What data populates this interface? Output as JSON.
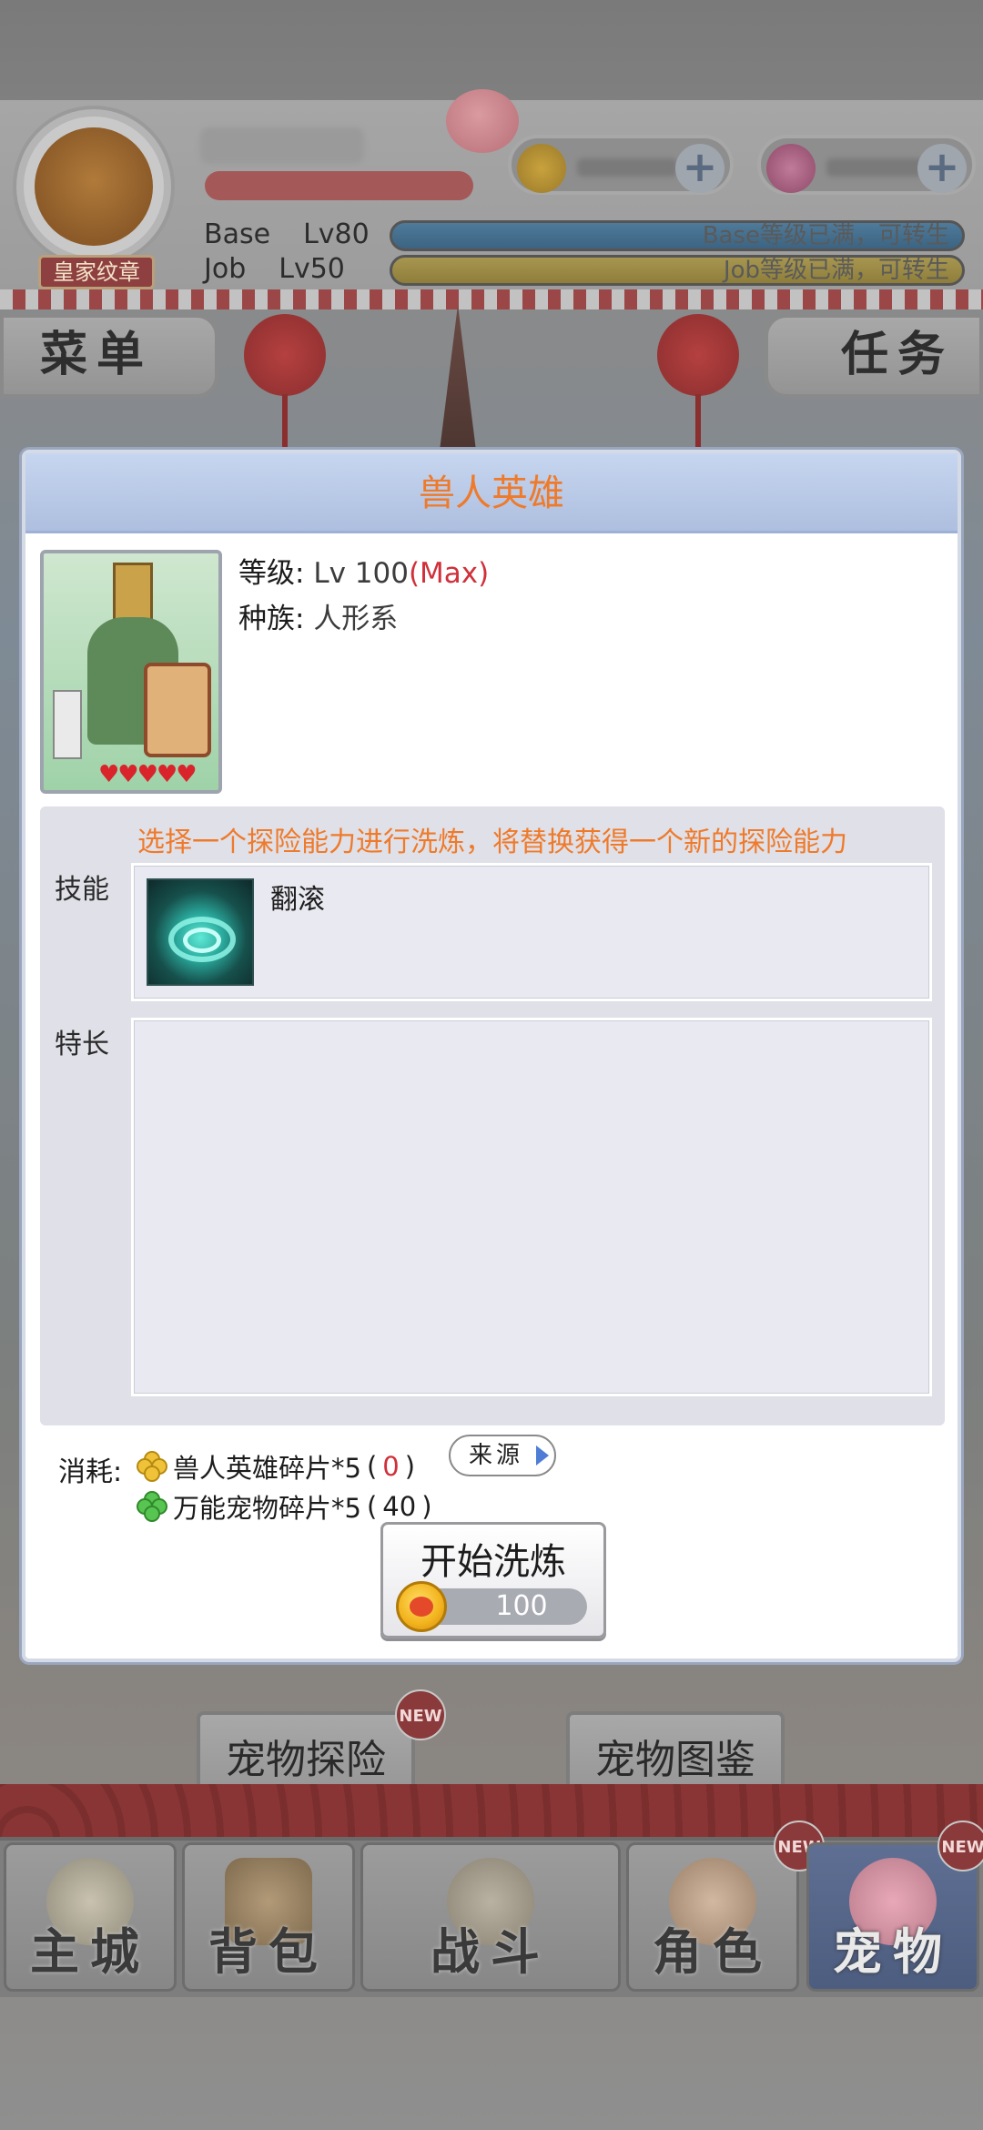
{
  "hud": {
    "badge": "皇家纹章",
    "base_label": "Base",
    "base_level": "Lv80",
    "base_status": "Base等级已满，可转生",
    "job_label": "Job",
    "job_level": "Lv50",
    "job_status": "Job等级已满，可转生"
  },
  "top_tabs": {
    "menu": "菜单",
    "tasks": "任务"
  },
  "dialog": {
    "title": "兽人英雄",
    "level_label": "等级:",
    "level_value": "Lv 100",
    "level_max": "(Max)",
    "race_label": "种族:",
    "race_value": "人形系",
    "refine_hint": "选择一个探险能力进行洗炼，将替换获得一个新的探险能力",
    "skill_label": "技能",
    "skill_name": "翻滚",
    "specialty_label": "特长",
    "cost_label": "消耗:",
    "cost_items": [
      {
        "name": "兽人英雄碎片*5",
        "owned": "0",
        "owned_color": "#d0303a"
      },
      {
        "name": "万能宠物碎片*5",
        "owned": "40",
        "owned_color": "#1c1c1c"
      }
    ],
    "source_button": "来源",
    "start_button": "开始洗炼",
    "start_cost": "100"
  },
  "bg_buttons": {
    "pet_explore": "宠物探险",
    "pet_atlas": "宠物图鉴",
    "new_badge": "NEW"
  },
  "navbar": [
    {
      "label": "主城",
      "icon": "castle-icon",
      "active": false
    },
    {
      "label": "背包",
      "icon": "backpack-icon",
      "active": false
    },
    {
      "label": "战斗",
      "icon": "crossed-swords-icon",
      "active": false
    },
    {
      "label": "角色",
      "icon": "character-icon",
      "active": false,
      "badge": "NEW"
    },
    {
      "label": "宠物",
      "icon": "pet-icon",
      "active": true,
      "badge": "NEW"
    }
  ],
  "colors": {
    "title_orange": "#ef7a2a",
    "max_red": "#d0303a",
    "header_blue": "#b8c8e8"
  }
}
